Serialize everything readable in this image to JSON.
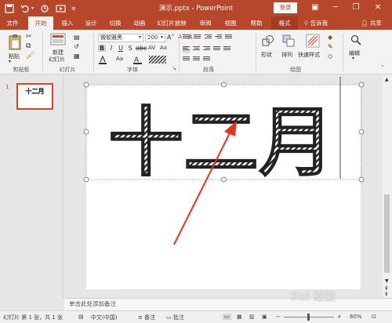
{
  "window": {
    "title": "演示.pptx  -  PowerPoint",
    "login": "登录",
    "minimize_icon": "minimize-icon",
    "maximize_icon": "restore-icon",
    "close_icon": "close-icon"
  },
  "tabs": {
    "file": "文件",
    "home": "开始",
    "insert": "插入",
    "design": "设计",
    "transitions": "切换",
    "animations": "动画",
    "slideshow": "幻灯片放映",
    "review": "审阅",
    "view": "视图",
    "help": "帮助",
    "format": "格式",
    "tellme": "告诉我",
    "share": "共享"
  },
  "ribbon": {
    "clipboard": {
      "paste": "粘贴",
      "group": "剪贴板"
    },
    "slides": {
      "new_slide_line1": "新建",
      "new_slide_line2": "幻灯片",
      "group": "幻灯片"
    },
    "font": {
      "name": "微软雅黑",
      "size": "200",
      "group": "字体"
    },
    "paragraph": {
      "group": "段落"
    },
    "drawing": {
      "shapes": "形状",
      "arrange": "排列",
      "quick_styles": "快速样式",
      "group": "绘图"
    },
    "editing": {
      "label": "编辑"
    }
  },
  "slide_panel": {
    "number": "1"
  },
  "slide": {
    "text": "十二月",
    "colors": {
      "stroke": "#222222",
      "arrow": "#e8321e"
    }
  },
  "notes": {
    "placeholder": "单击此处添加备注"
  },
  "status": {
    "slide_info": "幻灯片 第 1 张，共 1 张",
    "language": "中文(中国)",
    "notes": "备注",
    "comments": "批注",
    "zoom": "60%"
  },
  "watermark": {
    "text": "Bai 经验"
  }
}
